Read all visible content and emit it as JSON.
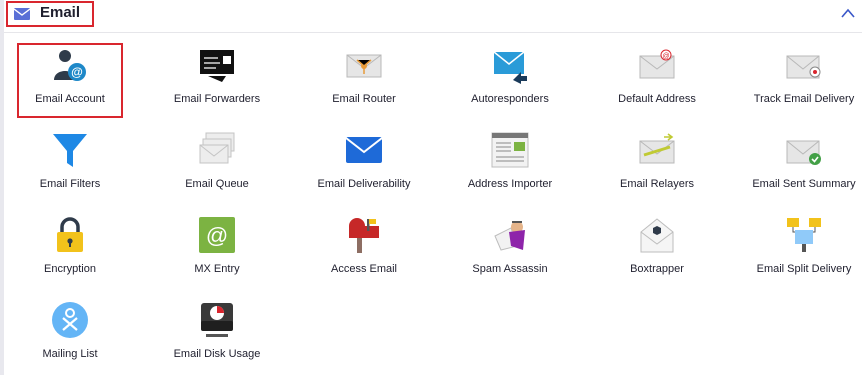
{
  "section": {
    "title": "Email",
    "accent": "#5a6fd6"
  },
  "items": [
    {
      "label": "Email Account",
      "icon": "user-at-icon"
    },
    {
      "label": "Email Forwarders",
      "icon": "forward-icon"
    },
    {
      "label": "Email Router",
      "icon": "router-envelope-icon"
    },
    {
      "label": "Autoresponders",
      "icon": "reply-envelope-icon"
    },
    {
      "label": "Default Address",
      "icon": "default-envelope-icon"
    },
    {
      "label": "Track Email Delivery",
      "icon": "track-envelope-icon"
    },
    {
      "label": "Email Filters",
      "icon": "funnel-icon"
    },
    {
      "label": "Email Queue",
      "icon": "queue-envelope-icon"
    },
    {
      "label": "Email Deliverability",
      "icon": "blue-envelope-icon"
    },
    {
      "label": "Address Importer",
      "icon": "importer-icon"
    },
    {
      "label": "Email Relayers",
      "icon": "relay-envelope-icon"
    },
    {
      "label": "Email Sent Summary",
      "icon": "sent-summary-icon"
    },
    {
      "label": "Encryption",
      "icon": "lock-icon"
    },
    {
      "label": "MX Entry",
      "icon": "mx-at-icon"
    },
    {
      "label": "Access Email",
      "icon": "mailbox-icon"
    },
    {
      "label": "Spam Assassin",
      "icon": "spam-icon"
    },
    {
      "label": "Boxtrapper",
      "icon": "boxtrapper-icon"
    },
    {
      "label": "Email Split Delivery",
      "icon": "split-delivery-icon"
    },
    {
      "label": "Mailing List",
      "icon": "mailing-list-icon"
    },
    {
      "label": "Email Disk Usage",
      "icon": "disk-usage-icon"
    }
  ]
}
